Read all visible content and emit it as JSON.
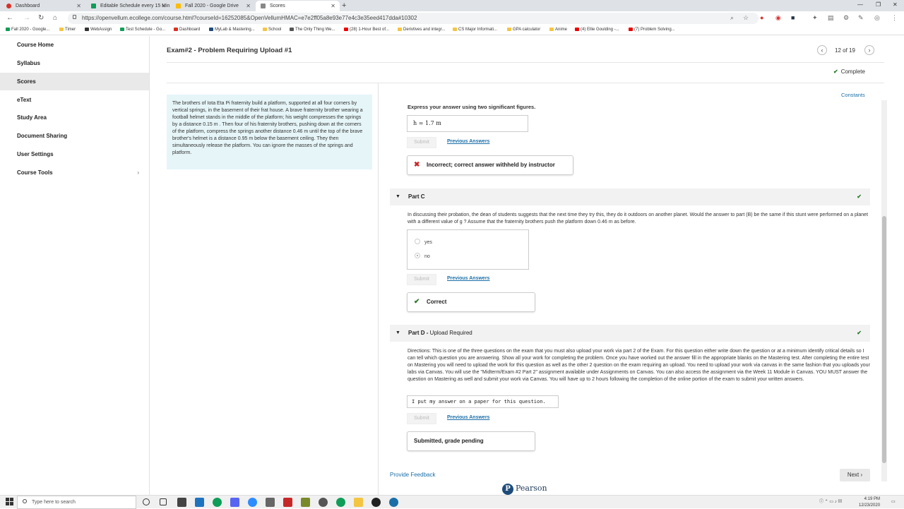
{
  "browser": {
    "tabs": [
      {
        "title": "Dashboard",
        "color": "#d93025"
      },
      {
        "title": "Editable Schedule every 15 Min",
        "color": "#0f9d58"
      },
      {
        "title": "Fall 2020 - Google Drive",
        "color": "#fbbc04"
      },
      {
        "title": "Scores",
        "color": "#888888"
      }
    ],
    "url": "https://openvellum.ecollege.com/course.html?courseId=16252085&OpenVellumHMAC=e7e2ff05a8e93e77e4c3e35eed417dda#10302",
    "bookmarks": [
      "Fall 2020 - Google...",
      "Timer",
      "WebAssign",
      "Test Schedule - Go...",
      "Dashboard",
      "MyLab & Mastering...",
      "School",
      "The Only Thing We...",
      "(28) 1-Hour Best of...",
      "Derivtives and integr...",
      "CS Major Informati...",
      "GPA calculator",
      "Anime",
      "(4) Ellie Goulding -...",
      "(7) Problem Solving..."
    ]
  },
  "sidebar": {
    "items": [
      {
        "label": "Course Home"
      },
      {
        "label": "Syllabus"
      },
      {
        "label": "Scores"
      },
      {
        "label": "eText"
      },
      {
        "label": "Study Area"
      },
      {
        "label": "Document Sharing"
      },
      {
        "label": "User Settings"
      },
      {
        "label": "Course Tools"
      }
    ]
  },
  "header": {
    "title": "Exam#2 - Problem Requiring Upload #1",
    "pager": "12 of 19",
    "status": "Complete"
  },
  "problem_text": "The brothers of Iota Eta Pi fraternity build a platform, supported at all four corners by vertical springs, in the basement of their frat house. A brave fraternity brother wearing a football helmet stands in the middle of the platform; his weight compresses the springs by a distance 0.15 m . Then four of his fraternity brothers, pushing down at the corners of the platform, compress the springs another distance 0.46 m until the top of the brave brother's helmet is a distance 0.95 m below the basement ceiling. They then simultaneously release the platform. You can ignore the masses of the springs and platform.",
  "constants_label": "Constants",
  "part_b": {
    "instruction": "Express your answer using two significant figures.",
    "answer": "h =  1.7  m",
    "submit": "Submit",
    "previous": "Previous Answers",
    "feedback": "Incorrect; correct answer withheld by instructor"
  },
  "part_c": {
    "title": "Part C",
    "question": "In discussing their probation, the dean of students suggests that the next time they try this, they do it outdoors on another planet. Would the answer to part (B) be the same if this stunt were performed on a planet with a different value of g ? Assume that the fraternity brothers push the platform down 0.46 m as before.",
    "options": [
      "yes",
      "no"
    ],
    "selected": "no",
    "submit": "Submit",
    "previous": "Previous Answers",
    "feedback": "Correct"
  },
  "part_d": {
    "title": "Part D",
    "subtitle": "Upload Required",
    "directions": "Directions:  This is one of the three questions on the exam that you must also upload your work via part 2 of the Exam.  For this question either write down the question or at a minimum identify critical details so I can tell which question you are answering.  Show all your work for completing the problem.  Once you have worked out the answer fill in the appropriate blanks on the Mastering test.  After completing the entire test on Mastering you will need to upload the work for this question as well as the other 2 question on the exam requiring an upload.  You need to upload your work via canvas in the same fashion that you uploads your labs via Canvas.  You will use the \"Midterm/Exam #2  Part 2\" assignment available under Assignments on Canvas.  You can also access the assignment via the Week 11 Module in Canvas.  YOU MUST answer the question on Mastering as well and submit your work via Canvas.  You will have up to 2 hours following the completion of the online portion of the exam to submit your written answers.",
    "answer": "I put my answer on a paper for this question.",
    "submit": "Submit",
    "previous": "Previous Answers",
    "feedback": "Submitted, grade pending"
  },
  "footer": {
    "provide_feedback": "Provide Feedback",
    "next": "Next",
    "brand": "Pearson"
  },
  "taskbar": {
    "search_placeholder": "Type here to search",
    "time": "4:19 PM",
    "date": "12/23/2020"
  }
}
